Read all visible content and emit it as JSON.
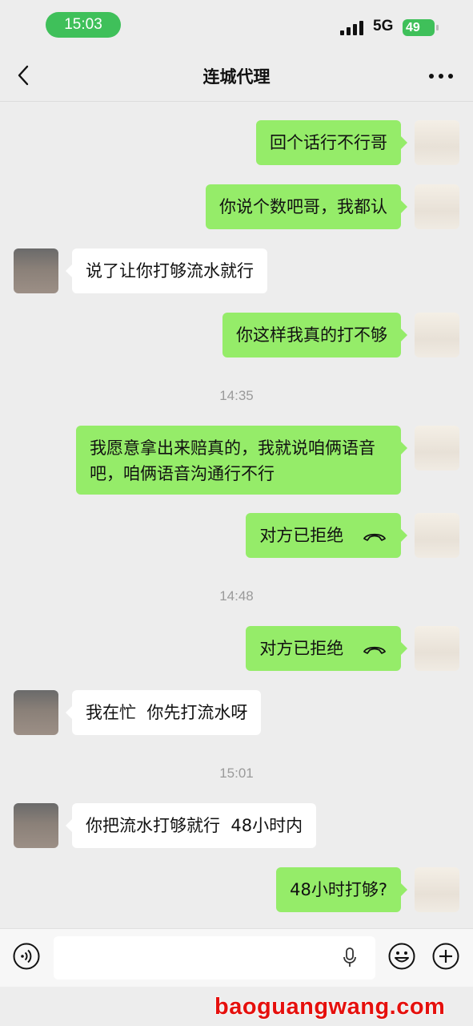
{
  "status": {
    "time": "15:03",
    "network": "5G",
    "battery": "49"
  },
  "header": {
    "title": "连城代理",
    "back_icon": "chevron-left-icon",
    "more_icon": "more-dots-icon"
  },
  "messages": [
    {
      "side": "right",
      "text": "回个话行不行哥"
    },
    {
      "side": "right",
      "text": "你说个数吧哥，我都认"
    },
    {
      "side": "left",
      "text": "说了让你打够流水就行"
    },
    {
      "side": "right",
      "text": "你这样我真的打不够"
    },
    {
      "time": "14:35"
    },
    {
      "side": "right",
      "text": "我愿意拿出来赔真的，我就说咱俩语音吧，咱俩语音沟通行不行"
    },
    {
      "side": "right",
      "text": "对方已拒绝",
      "call": true
    },
    {
      "time": "14:48"
    },
    {
      "side": "right",
      "text": "对方已拒绝",
      "call": true
    },
    {
      "side": "left",
      "text": "我在忙  你先打流水呀"
    },
    {
      "time": "15:01"
    },
    {
      "side": "left",
      "text": "你把流水打够就行  48小时内"
    },
    {
      "side": "right",
      "text": "48小时打够?"
    }
  ],
  "input_bar": {
    "voice_icon": "voice-icon",
    "mic_icon": "mic-icon",
    "emoji_icon": "emoji-icon",
    "plus_icon": "plus-icon"
  },
  "colors": {
    "sent_bubble": "#95ec69",
    "received_bubble": "#ffffff",
    "background": "#ededed",
    "watermark": "#e5100d"
  },
  "watermark": "baoguangwang.com"
}
